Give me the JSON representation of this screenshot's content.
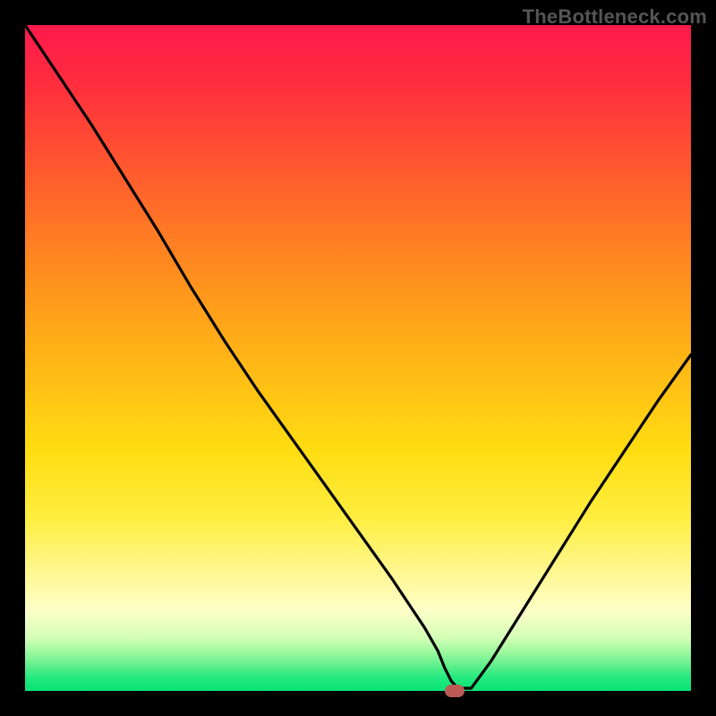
{
  "watermark": "TheBottleneck.com",
  "chart_data": {
    "type": "line",
    "title": "",
    "xlabel": "",
    "ylabel": "",
    "xlim": [
      0,
      100
    ],
    "ylim": [
      0,
      100
    ],
    "grid": false,
    "legend": false,
    "marker": {
      "x": 64.5,
      "y": 0,
      "color": "#bc5a57"
    },
    "series": [
      {
        "name": "bottleneck-curve",
        "color": "#000000",
        "x": [
          0,
          5,
          10,
          15,
          20,
          25,
          30,
          35,
          40,
          45,
          50,
          55,
          58,
          60,
          62,
          63,
          64,
          65,
          67,
          70,
          75,
          80,
          85,
          90,
          95,
          100
        ],
        "y": [
          100,
          92.5,
          85,
          77,
          69,
          60.5,
          52.5,
          45,
          38,
          31,
          24,
          17,
          12.5,
          9.5,
          6,
          3.5,
          1.5,
          0.4,
          0.4,
          4.5,
          12.5,
          20.5,
          28.5,
          36,
          43.5,
          50.5
        ]
      }
    ],
    "gradient_stops": [
      {
        "pos": 0,
        "color": "#ff1a4d"
      },
      {
        "pos": 8,
        "color": "#ff2b3f"
      },
      {
        "pos": 22,
        "color": "#ff5a2e"
      },
      {
        "pos": 36,
        "color": "#ff8a1f"
      },
      {
        "pos": 50,
        "color": "#ffb516"
      },
      {
        "pos": 64,
        "color": "#ffdd12"
      },
      {
        "pos": 74,
        "color": "#ffee40"
      },
      {
        "pos": 82,
        "color": "#fff78f"
      },
      {
        "pos": 88,
        "color": "#fdffc8"
      },
      {
        "pos": 92,
        "color": "#d4ffb6"
      },
      {
        "pos": 94,
        "color": "#a0f9a0"
      },
      {
        "pos": 96,
        "color": "#66f08e"
      },
      {
        "pos": 98,
        "color": "#24e97e"
      },
      {
        "pos": 100,
        "color": "#08e275"
      }
    ]
  }
}
